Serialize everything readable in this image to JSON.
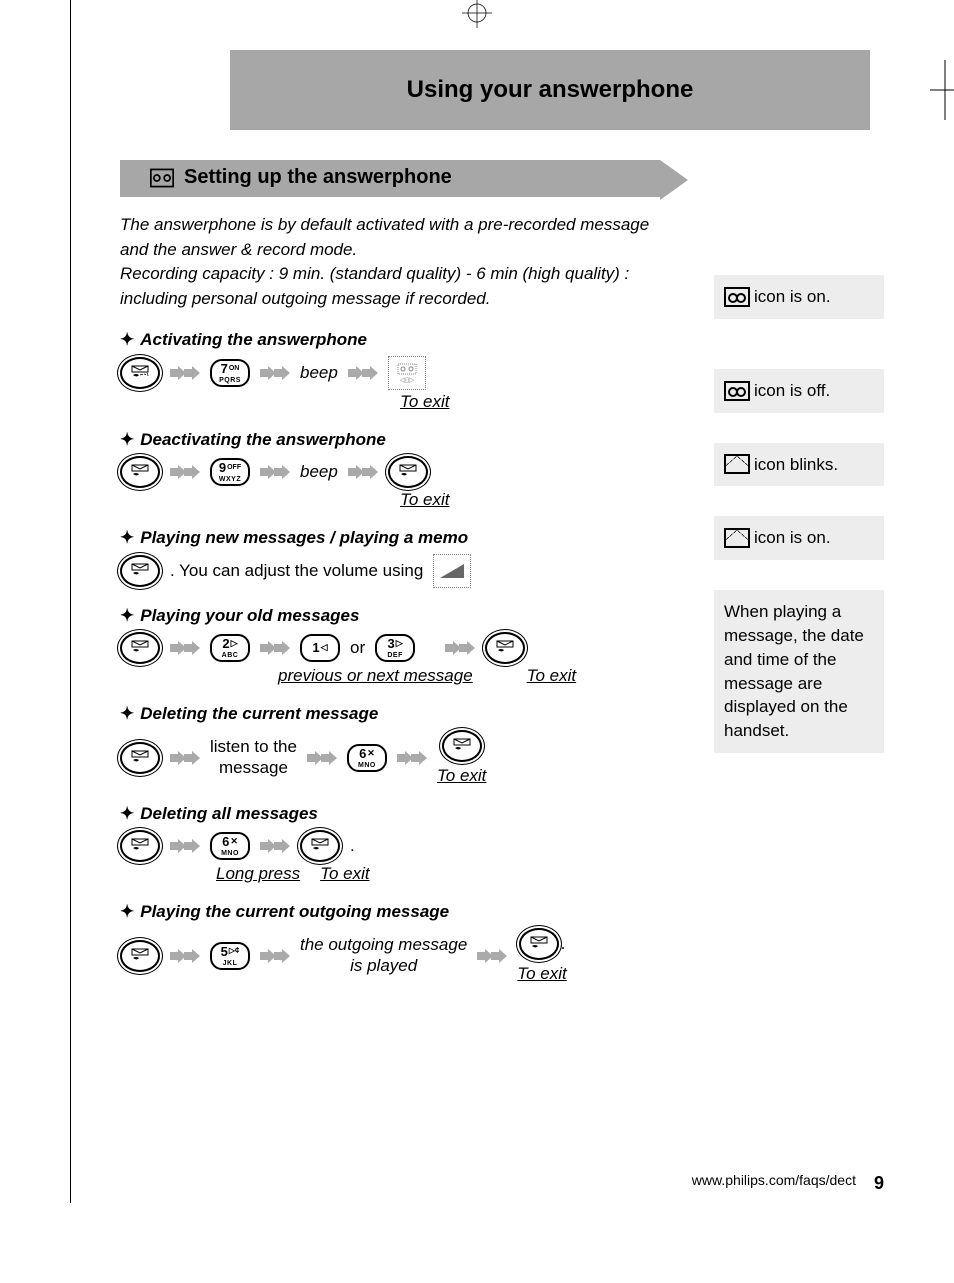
{
  "title": "Using your answerphone",
  "section_title": "Setting up the answerphone",
  "intro": "The answerphone is by default activated  with a pre-recorded message and the answer & record mode.\nRecording capacity : 9 min. (standard quality) - 6 min (high quality) : including personal outgoing message if recorded.",
  "bullets": {
    "activate": {
      "head": "Activating the answerphone",
      "beep": "beep",
      "exit": "To exit"
    },
    "deactivate": {
      "head": "Deactivating the answerphone",
      "beep": "beep",
      "exit": "To exit"
    },
    "play_new": {
      "head": "Playing new messages / playing a memo",
      "text": ". You can adjust the volume using"
    },
    "play_old": {
      "head": "Playing your old messages",
      "or": "or",
      "sub": "previous or next message",
      "exit": "To exit"
    },
    "del_current": {
      "head": "Deleting the current message",
      "listen1": "listen to the",
      "listen2": "message",
      "exit": "To exit"
    },
    "del_all": {
      "head": "Deleting all messages",
      "long_press": "Long press",
      "exit": "To exit",
      "dot": "."
    },
    "play_ogm": {
      "head": "Playing the current outgoing message",
      "msg1": "the outgoing message",
      "msg2": "is played",
      "exit": "To exit",
      "dot": "."
    }
  },
  "notes": {
    "icon_on": "icon is on.",
    "icon_off": "icon is off.",
    "icon_blinks": "icon blinks.",
    "icon_is_on2": "icon is on.",
    "date_time": "When playing a message, the date and time of the message are displayed on the handset."
  },
  "keys": {
    "ans": "ans",
    "7": {
      "n": "7",
      "s": "ON",
      "l": "PQRS"
    },
    "9": {
      "n": "9",
      "s": "OFF",
      "l": "WXYZ"
    },
    "2": {
      "n": "2",
      "s": "▷",
      "l": "ABC"
    },
    "1": {
      "n": "1",
      "s": "◁"
    },
    "3": {
      "n": "3",
      "s": "▷",
      "l": "DEF"
    },
    "6": {
      "n": "6",
      "s": "✕",
      "l": "MNO"
    },
    "5": {
      "n": "5",
      "s": "▷¢",
      "l": "JKL"
    }
  },
  "footer": {
    "url": "www.philips.com/faqs/dect",
    "page": "9"
  }
}
